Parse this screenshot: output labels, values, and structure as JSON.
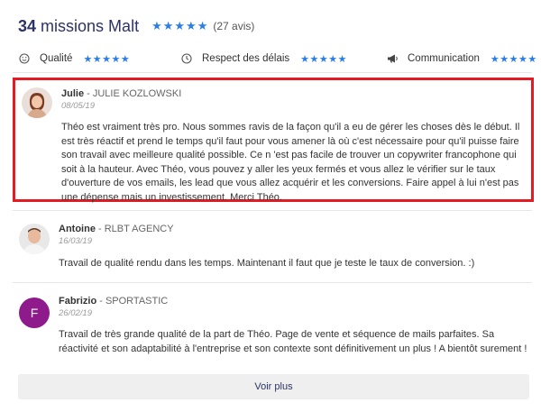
{
  "header": {
    "count": "34",
    "missions_label": "missions Malt",
    "stars": "★★★★★",
    "reviews_count": "(27 avis)"
  },
  "criteria": [
    {
      "icon": "smile-icon",
      "label": "Qualité",
      "stars": "★★★★★"
    },
    {
      "icon": "clock-icon",
      "label": "Respect des délais",
      "stars": "★★★★★"
    },
    {
      "icon": "megaphone-icon",
      "label": "Communication",
      "stars": "★★★★★"
    }
  ],
  "reviews": [
    {
      "name": "Julie",
      "company": "JULIE KOZLOWSKI",
      "date": "08/05/19",
      "text": "Théo est vraiment très pro. Nous sommes ravis de la façon qu'il a eu de gérer les choses dès le début. Il est très réactif et prend le temps qu'il faut pour vous amener là où c'est nécessaire pour qu'il puisse faire son travail avec meilleure qualité possible. Ce n 'est pas facile de trouver un copywriter francophone qui soit à la hauteur. Avec Théo, vous pouvez y aller les yeux fermés et vous allez le vérifier sur le taux d'ouverture de vos emails, les lead que vous allez acquérir et les conversions. Faire appel à lui n'est pas une dépense mais un investissement. Merci Théo.",
      "highlight_color": "#e31b23"
    },
    {
      "name": "Antoine",
      "company": "RLBT AGENCY",
      "date": "16/03/19",
      "text": "Travail de qualité rendu dans les temps. Maintenant il faut que je teste le taux de conversion. :)"
    },
    {
      "name": "Fabrizio",
      "company": "SPORTASTIC",
      "date": "26/02/19",
      "avatar_letter": "F",
      "avatar_color": "#8e1a8c",
      "text": "Travail de très grande qualité de la part de Théo. Page de vente et séquence de mails parfaites. Sa réactivité et son adaptabilité à l'entreprise et son contexte sont définitivement un plus ! A bientôt surement !"
    }
  ],
  "separator": " - ",
  "more_button": "Voir plus",
  "colors": {
    "title": "#2c3367",
    "stars": "#2b7de9",
    "highlight": "#e31b23",
    "button_bg": "#efefef"
  }
}
